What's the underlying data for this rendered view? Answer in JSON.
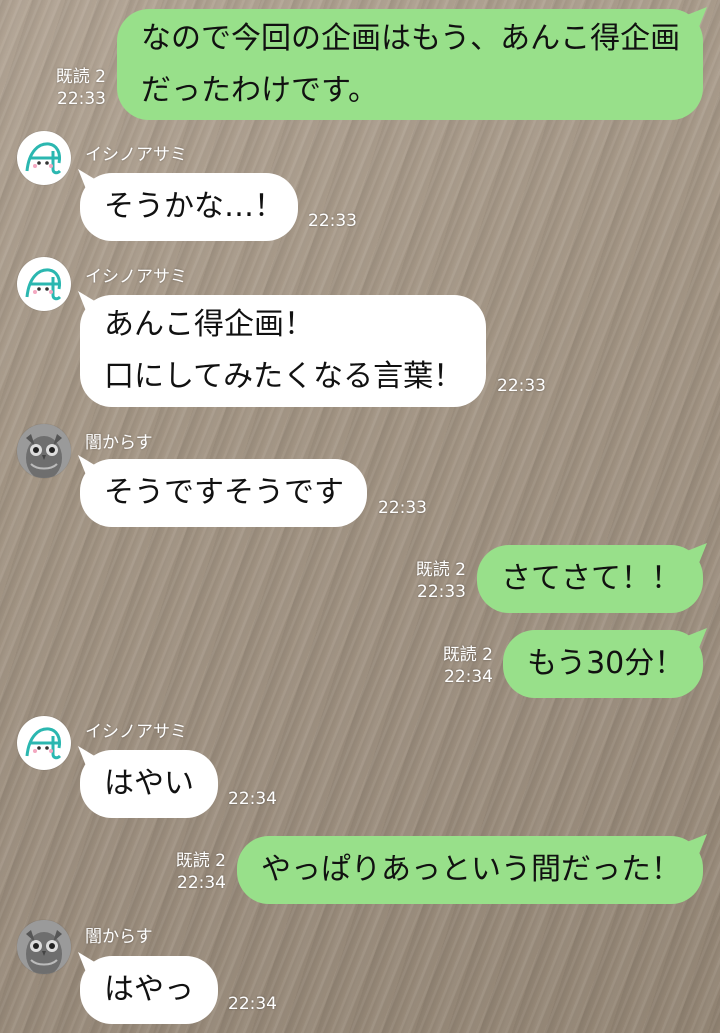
{
  "users": {
    "ishino": {
      "name": "イシノアサミ"
    },
    "yami": {
      "name": "闇からす"
    }
  },
  "messages": [
    {
      "lines": [
        "なので今回の企画はもう、あんこ得企画",
        "だったわけです。"
      ],
      "read": "既読 2",
      "time": "22:33"
    },
    {
      "lines": [
        "そうかな…！"
      ],
      "time": "22:33"
    },
    {
      "lines": [
        "あんこ得企画！",
        "口にしてみたくなる言葉！"
      ],
      "time": "22:33"
    },
    {
      "lines": [
        "そうですそうです"
      ],
      "time": "22:33"
    },
    {
      "lines": [
        "さてさて！！"
      ],
      "read": "既読 2",
      "time": "22:33"
    },
    {
      "lines": [
        "もう30分！"
      ],
      "read": "既読 2",
      "time": "22:34"
    },
    {
      "lines": [
        "はやい"
      ],
      "time": "22:34"
    },
    {
      "lines": [
        "やっぱりあっという間だった！"
      ],
      "read": "既読 2",
      "time": "22:34"
    },
    {
      "lines": [
        "はやっ"
      ],
      "time": "22:34"
    }
  ],
  "colors": {
    "outgoing": "#98e08a",
    "incoming": "#ffffff",
    "meta_text": "#ffffff"
  }
}
